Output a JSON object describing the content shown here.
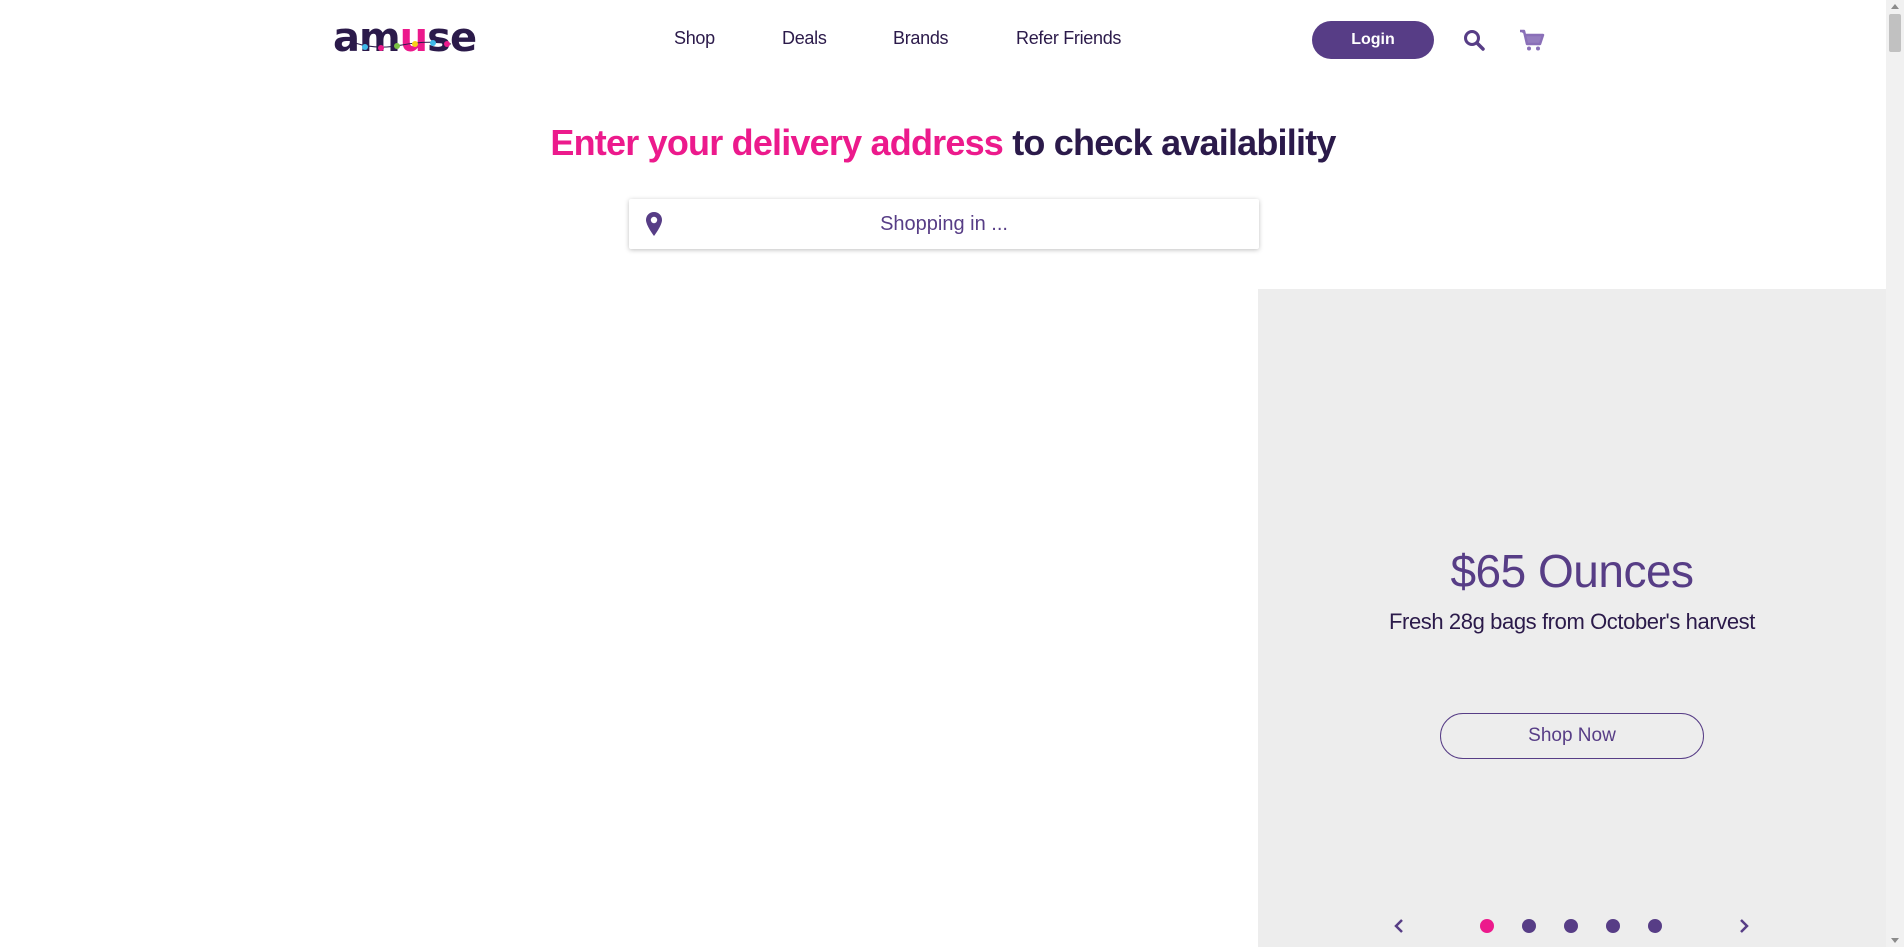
{
  "brand": {
    "logo_text_a": "am",
    "logo_text_u": "u",
    "logo_text_b": "se",
    "primary_color": "#573d86",
    "accent_color": "#ec1a8c",
    "text_color": "#2b1a4a"
  },
  "nav": {
    "items": [
      {
        "label": "Shop"
      },
      {
        "label": "Deals"
      },
      {
        "label": "Brands"
      },
      {
        "label": "Refer Friends"
      }
    ],
    "login_label": "Login",
    "search_icon": "search-icon",
    "cart_icon": "cart-icon"
  },
  "hero": {
    "headline_highlight": "Enter your delivery address",
    "headline_rest": " to check availability",
    "address_placeholder": "Shopping in ...",
    "address_icon": "map-pin-icon"
  },
  "promo": {
    "title": "$65 Ounces",
    "subtitle": "Fresh 28g bags from October's harvest",
    "cta_label": "Shop Now",
    "slide_count": 5,
    "active_slide": 1,
    "prev_icon": "chevron-left-icon",
    "next_icon": "chevron-right-icon"
  }
}
